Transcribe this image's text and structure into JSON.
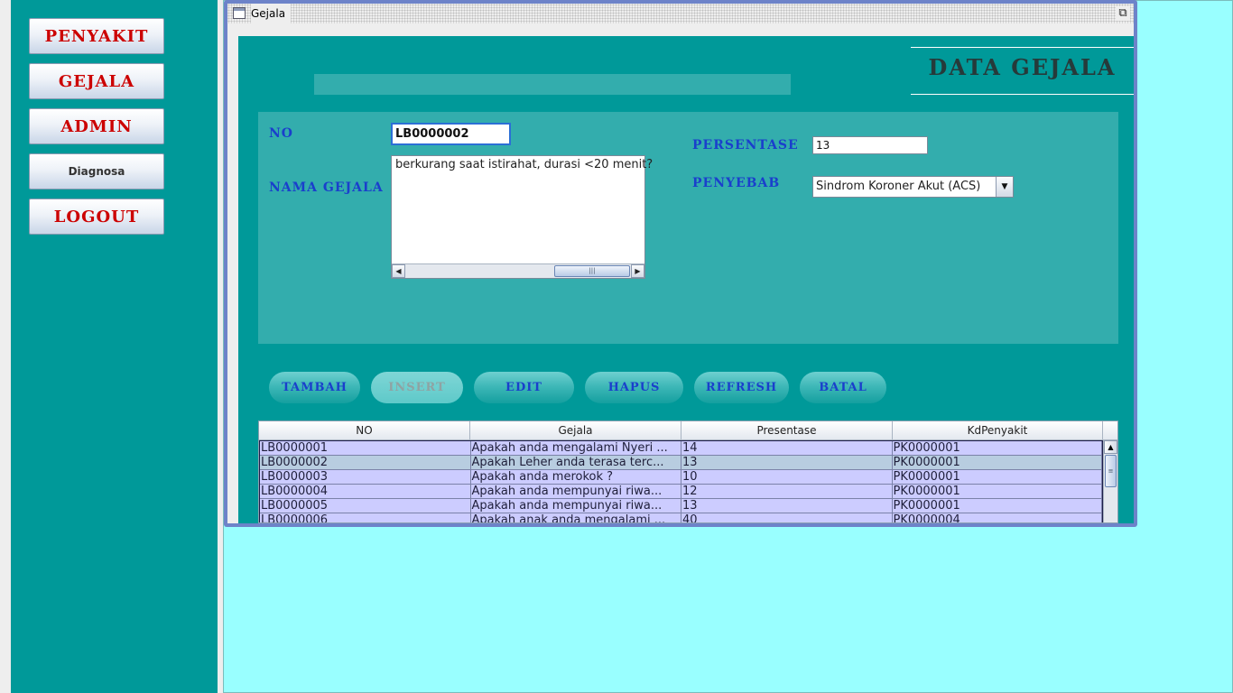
{
  "sidebar": {
    "buttons": [
      "PENYAKIT",
      "GEJALA",
      "ADMIN",
      "Diagnosa",
      "LOGOUT"
    ]
  },
  "window": {
    "title": "Gejala",
    "maximize_icon": "restore-icon"
  },
  "header": {
    "title": "DATA GEJALA"
  },
  "form": {
    "no_label": "NO",
    "no_value": "LB0000002",
    "nama_gejala_label": "NAMA GEJALA",
    "nama_gejala_value": "berkurang saat istirahat, durasi <20 menit?",
    "persentase_label": "PERSENTASE",
    "persentase_value": "13",
    "penyebab_label": "PENYEBAB",
    "penyebab_value": "Sindrom Koroner Akut (ACS)"
  },
  "actions": {
    "tambah": "TAMBAH",
    "insert": "INSERT",
    "edit": "EDIT",
    "hapus": "HAPUS",
    "refresh": "REFRESH",
    "batal": "BATAL"
  },
  "table": {
    "columns": [
      "NO",
      "Gejala",
      "Presentase",
      "KdPenyakit"
    ],
    "rows": [
      [
        "LB0000001",
        "Apakah anda mengalami Nyeri ...",
        "14",
        "PK0000001"
      ],
      [
        "LB0000002",
        "Apakah Leher anda terasa terc...",
        "13",
        "PK0000001"
      ],
      [
        "LB0000003",
        "Apakah anda merokok ?",
        "10",
        "PK0000001"
      ],
      [
        "LB0000004",
        "Apakah anda mempunyai riwa...",
        "12",
        "PK0000001"
      ],
      [
        "LB0000005",
        "Apakah anda mempunyai riwa...",
        "13",
        "PK0000001"
      ],
      [
        "LB0000006",
        "Apakah anak anda mengalami ...",
        "40",
        "PK0000004"
      ]
    ]
  },
  "colors": {
    "sidebar": "#009999",
    "desktop": "#99ffff",
    "panel": "#33adad",
    "nav_text": "#cc0000",
    "label_text": "#1a3fcc",
    "row": "#ccccff",
    "row_selected": "#b8cde0"
  }
}
